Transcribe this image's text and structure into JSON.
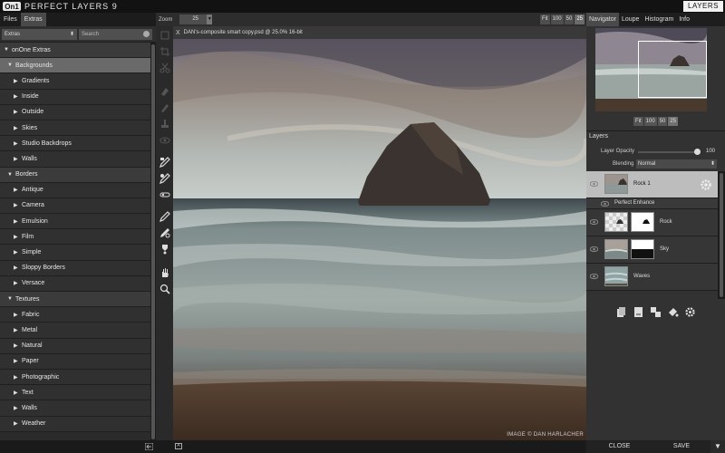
{
  "app": {
    "logo": "On1",
    "title": "PERFECT LAYERS 9",
    "mode_button": "LAYERS"
  },
  "left_panel": {
    "tabs": [
      {
        "label": "Files"
      },
      {
        "label": "Extras"
      }
    ],
    "category_select": "Extras",
    "search_placeholder": "Search",
    "tree": [
      {
        "label": "onOne Extras",
        "level": 1,
        "expanded": true
      },
      {
        "label": "Backgrounds",
        "level": 2,
        "expanded": true,
        "selected": true
      },
      {
        "label": "Gradients",
        "level": 3
      },
      {
        "label": "Inside",
        "level": 3
      },
      {
        "label": "Outside",
        "level": 3
      },
      {
        "label": "Skies",
        "level": 3
      },
      {
        "label": "Studio Backdrops",
        "level": 3
      },
      {
        "label": "Walls",
        "level": 3
      },
      {
        "label": "Borders",
        "level": 2,
        "expanded": true
      },
      {
        "label": "Antique",
        "level": 3
      },
      {
        "label": "Camera",
        "level": 3
      },
      {
        "label": "Emulsion",
        "level": 3
      },
      {
        "label": "Film",
        "level": 3
      },
      {
        "label": "Simple",
        "level": 3
      },
      {
        "label": "Sloppy Borders",
        "level": 3
      },
      {
        "label": "Versace",
        "level": 3
      },
      {
        "label": "Textures",
        "level": 2,
        "expanded": true
      },
      {
        "label": "Fabric",
        "level": 3
      },
      {
        "label": "Metal",
        "level": 3
      },
      {
        "label": "Natural",
        "level": 3
      },
      {
        "label": "Paper",
        "level": 3
      },
      {
        "label": "Photographic",
        "level": 3
      },
      {
        "label": "Text",
        "level": 3
      },
      {
        "label": "Walls",
        "level": 3
      },
      {
        "label": "Weather",
        "level": 3
      }
    ]
  },
  "toolbar": {
    "zoom_label": "Zoom",
    "zoom_value": "25",
    "zoom_buttons": [
      "Fit",
      "100",
      "50",
      "25"
    ],
    "active_zoom": "25"
  },
  "document": {
    "tab_close": "X",
    "tab_title": "DAN's-composite smart copy.psd @ 25.0% 16-bit",
    "credit": "IMAGE © DAN HARLACHER"
  },
  "right_panel": {
    "tabs": [
      "Navigator",
      "Loupe",
      "Histogram",
      "Info"
    ],
    "nav_zoom_buttons": [
      "Fit",
      "100",
      "50",
      "25"
    ],
    "layers_header": "Layers",
    "opacity_label": "Layer Opacity",
    "opacity_value": "100",
    "opacity_fraction": 1.0,
    "blending_label": "Blending",
    "blending_value": "Normal",
    "layers": [
      {
        "name": "Rock 1",
        "selected": true,
        "gear": true
      },
      {
        "sub": true,
        "name": "Perfect Enhance"
      },
      {
        "name": "Rock",
        "mask": true
      },
      {
        "name": "Sky",
        "mask": true
      },
      {
        "name": "Waves"
      }
    ]
  },
  "bottom": {
    "close_label": "CLOSE",
    "save_label": "SAVE",
    "save_menu": "▼"
  },
  "colors": {
    "accent_selected_row": "#6a6a6a",
    "selected_layer": "#bdbdbd",
    "topbar": "#121212"
  }
}
